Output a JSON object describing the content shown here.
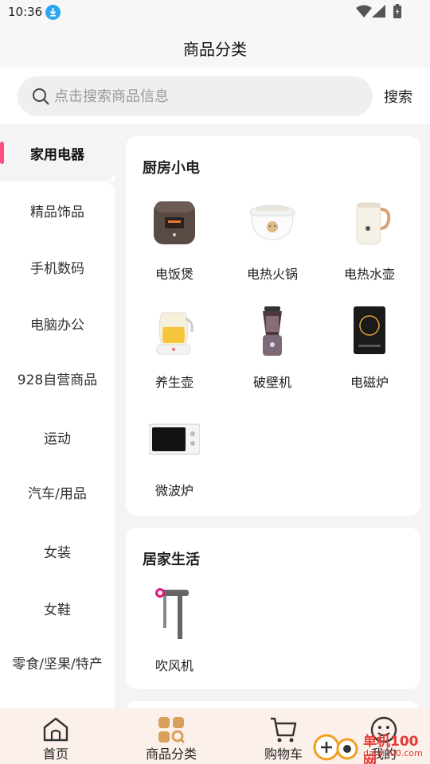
{
  "status": {
    "time": "10:36"
  },
  "header": {
    "title": "商品分类"
  },
  "search": {
    "placeholder": "点击搜索商品信息",
    "button": "搜索"
  },
  "sidebar": {
    "items": [
      {
        "label": "家用电器",
        "active": true
      },
      {
        "label": "精品饰品"
      },
      {
        "label": "手机数码"
      },
      {
        "label": "电脑办公"
      },
      {
        "label": "928自营商品"
      },
      {
        "label": "运动"
      },
      {
        "label": "汽车/用品"
      },
      {
        "label": "女装"
      },
      {
        "label": "女鞋"
      },
      {
        "label": "零食/坚果/特产"
      }
    ]
  },
  "sections": [
    {
      "title": "厨房小电",
      "products": [
        {
          "label": "电饭煲",
          "icon": "rice-cooker"
        },
        {
          "label": "电热火锅",
          "icon": "hot-pot"
        },
        {
          "label": "电热水壶",
          "icon": "kettle"
        },
        {
          "label": "养生壶",
          "icon": "health-pot"
        },
        {
          "label": "破壁机",
          "icon": "blender"
        },
        {
          "label": "电磁炉",
          "icon": "induction-cooker"
        },
        {
          "label": "微波炉",
          "icon": "microwave"
        }
      ]
    },
    {
      "title": "居家生活",
      "products": [
        {
          "label": "吹风机",
          "icon": "hair-dryer"
        }
      ]
    }
  ],
  "bottom_nav": [
    {
      "label": "首页",
      "icon": "home-icon"
    },
    {
      "label": "商品分类",
      "icon": "category-icon",
      "active": true
    },
    {
      "label": "购物车",
      "icon": "cart-icon"
    },
    {
      "label": "我的",
      "icon": "profile-icon"
    }
  ],
  "watermark": {
    "text": "单机100网",
    "sub": "danji100.com"
  },
  "colors": {
    "accent": "#ff4d7d",
    "nav_bg": "#fbf1ea",
    "active_icon": "#d9a05b"
  }
}
